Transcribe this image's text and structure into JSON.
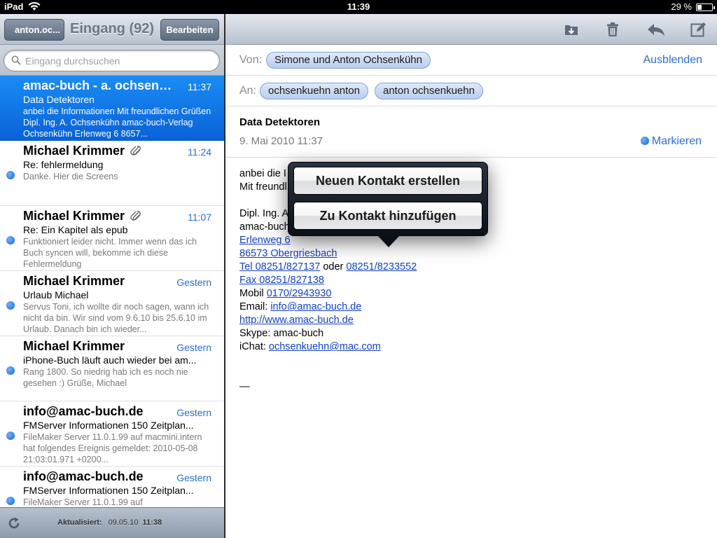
{
  "status_bar": {
    "carrier": "iPad",
    "time": "11:39",
    "battery": "29 %",
    "battery_level": 0.29
  },
  "left_nav": {
    "back_label": "anton.oc...",
    "title": "Eingang (92)",
    "edit_label": "Bearbeiten"
  },
  "search": {
    "placeholder": "Eingang durchsuchen"
  },
  "messages": [
    {
      "sender": "amac-buch - a. ochsenkühn",
      "time": "11:37",
      "subject": "Data Detektoren",
      "preview": "anbei die Informationen Mit freundlichen Grüßen Dipl. Ing. A. Ochsenkühn amac-buch-Verlag Ochsenkühn Erlenweg 6 8657...",
      "selected": true,
      "unread": false,
      "attachment": false
    },
    {
      "sender": "Michael Krimmer",
      "time": "11:24",
      "subject": "Re: fehlermeldung",
      "preview": "Danke. Hier die Screens",
      "selected": false,
      "unread": true,
      "attachment": true
    },
    {
      "sender": "Michael Krimmer",
      "time": "11:07",
      "subject": "Re: Ein Kapitel als epub",
      "preview": "Funktioniert leider nicht. Immer wenn das ich Buch syncen will, bekomme ich diese Fehlermeldung",
      "selected": false,
      "unread": true,
      "attachment": true
    },
    {
      "sender": "Michael Krimmer",
      "time": "Gestern",
      "subject": "Urlaub Michael",
      "preview": "Servus Toni, ich wollte dir noch sagen, wann ich nicht da bin. Wir sind vom 9.6.10 bis 25.6.10 im Urlaub. Danach bin ich wieder...",
      "selected": false,
      "unread": true,
      "attachment": false
    },
    {
      "sender": "Michael Krimmer",
      "time": "Gestern",
      "subject": "iPhone-Buch läuft auch wieder bei am...",
      "preview": "Rang 1800. So niedrig hab ich es noch nie gesehen :) Grüße, Michael",
      "selected": false,
      "unread": true,
      "attachment": false
    },
    {
      "sender": "info@amac-buch.de",
      "time": "Gestern",
      "subject": "FMServer Informationen 150 Zeitplan...",
      "preview": "FileMaker Server 11.0.1.99 auf macmini.intern hat folgendes Ereignis gemeldet: 2010-05-08 21:03:01.971 +0200...",
      "selected": false,
      "unread": true,
      "attachment": false
    },
    {
      "sender": "info@amac-buch.de",
      "time": "Gestern",
      "subject": "FMServer Informationen 150 Zeitplan...",
      "preview": "FileMaker Server 11.0.1.99 auf",
      "selected": false,
      "unread": true,
      "attachment": false
    }
  ],
  "left_toolbar": {
    "updated_label": "Aktualisiert:",
    "updated_date": "09.05.10",
    "updated_time": "11:38"
  },
  "mail": {
    "from_label": "Von:",
    "from": "Simone und Anton Ochsenkühn",
    "hide_label": "Ausblenden",
    "to_label": "An:",
    "to": [
      "ochsenkuehn anton",
      "anton ochsenkuehn"
    ],
    "subject": "Data Detektoren",
    "date": "9. Mai 2010 11:37",
    "mark_label": "Markieren",
    "body": {
      "line1": "anbei die I",
      "line2": "Mit freundl",
      "line3": "Dipl. Ing. A",
      "line4": "amac-buch",
      "street": "Erlenweg 6",
      "city": "86573 Obergriesbach",
      "tel": "Tel 08251/827137",
      "or": " oder ",
      "tel2": "08251/8233552",
      "fax": "Fax 08251/827138",
      "mobile_label": "Mobil ",
      "mobile": "0170/2943930",
      "email_label": "Email: ",
      "email": "info@amac-buch.de",
      "web": "http://www.amac-buch.de",
      "skype": "Skype: amac-buch",
      "ichat_label": "iChat: ",
      "ichat": "ochsenkuehn@mac.com",
      "signature_sep": "—"
    }
  },
  "popover": {
    "create_contact": "Neuen Kontakt erstellen",
    "add_to_contact": "Zu Kontakt hinzufügen"
  },
  "colors": {
    "accent": "#2a6ed8",
    "selection": "#0962d8",
    "unread_dot": "#1463d9",
    "link": "#1340c9"
  }
}
